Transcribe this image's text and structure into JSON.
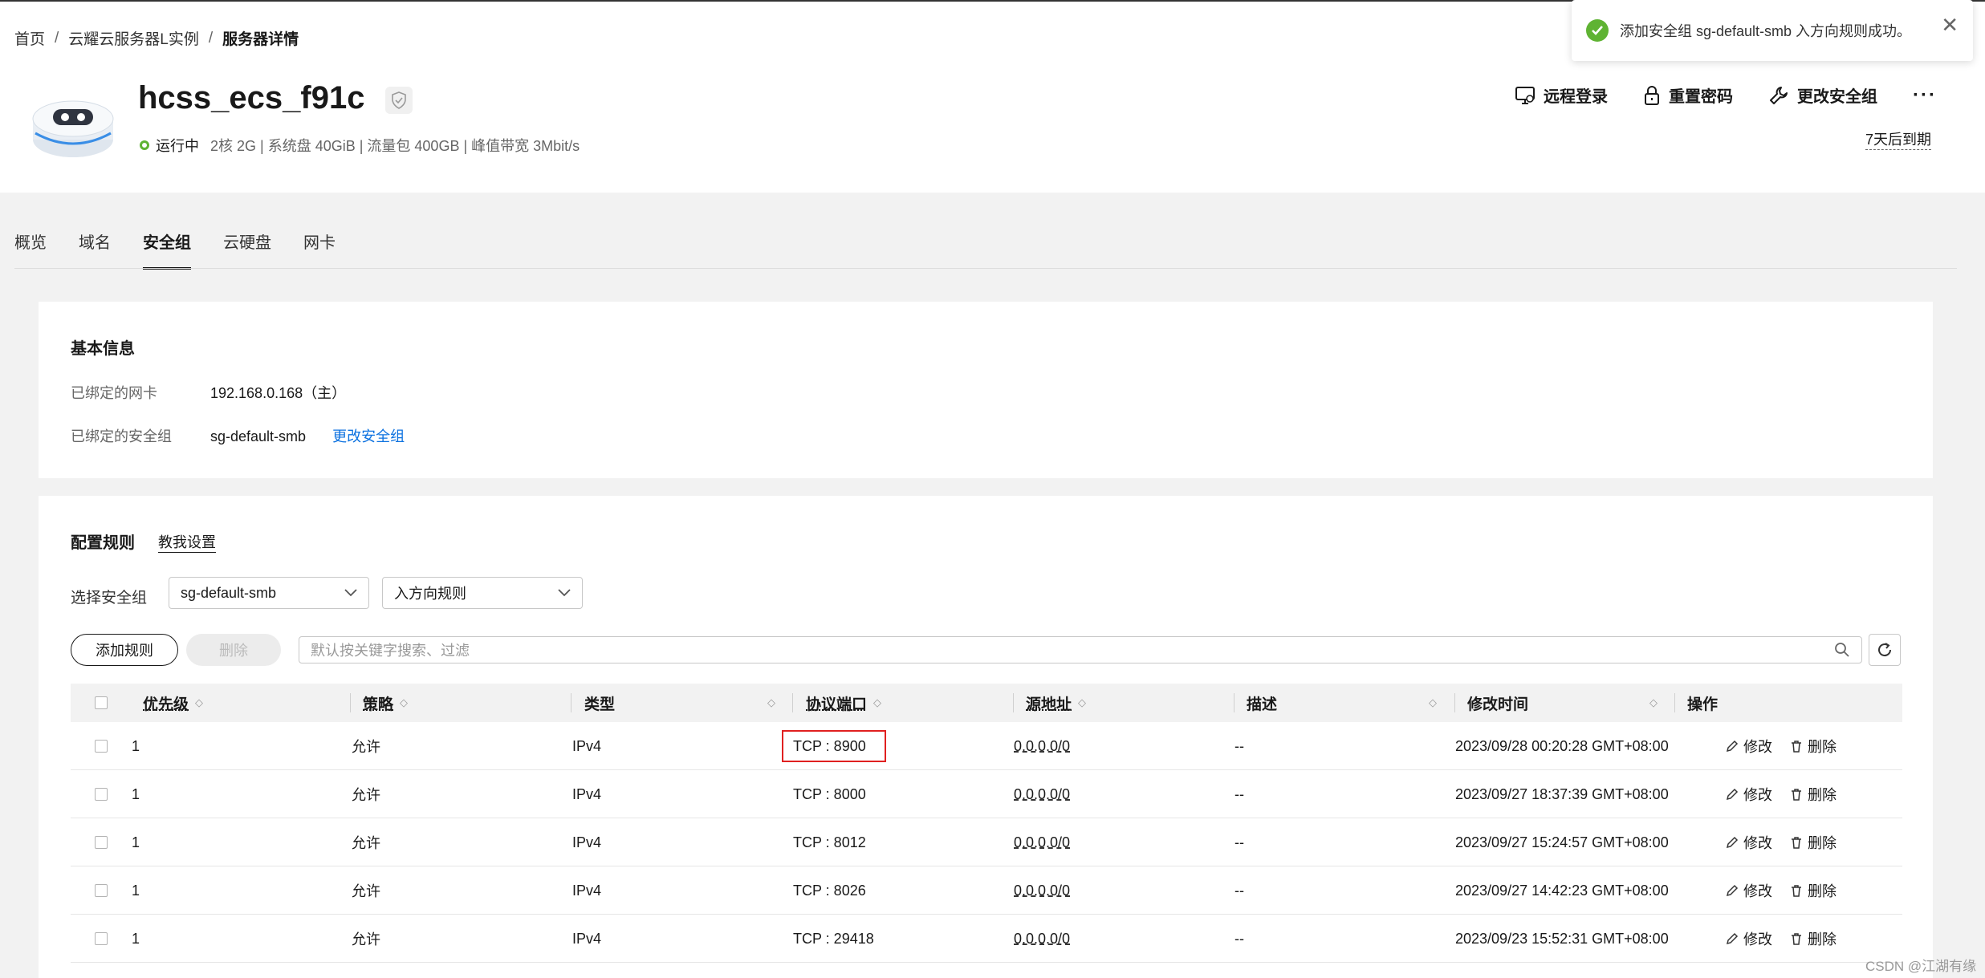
{
  "breadcrumb": {
    "home": "首页",
    "sep": "/",
    "level2": "云耀云服务器L实例",
    "current": "服务器详情"
  },
  "server": {
    "name": "hcss_ecs_f91c",
    "status": "运行中",
    "specs": "2核  2G | 系统盘 40GiB | 流量包 400GB | 峰值带宽 3Mbit/s",
    "expire": "7天后到期"
  },
  "actions": {
    "remote_login": "远程登录",
    "reset_password": "重置密码",
    "change_sg": "更改安全组",
    "more": "···"
  },
  "toast": {
    "message": "添加安全组 sg-default-smb 入方向规则成功。"
  },
  "tabs": [
    "概览",
    "域名",
    "安全组",
    "云硬盘",
    "网卡"
  ],
  "basic": {
    "title": "基本信息",
    "nic_label": "已绑定的网卡",
    "nic_value": "192.168.0.168（主）",
    "sg_label": "已绑定的安全组",
    "sg_value": "sg-default-smb",
    "sg_link": "更改安全组"
  },
  "rules": {
    "title": "配置规则",
    "guide": "教我设置",
    "select_label": "选择安全组",
    "sg_select": "sg-default-smb",
    "direction_select": "入方向规则",
    "add_btn": "添加规则",
    "delete_btn": "删除",
    "search_placeholder": "默认按关键字搜索、过滤"
  },
  "table": {
    "headers": {
      "priority": "优先级",
      "policy": "策略",
      "type": "类型",
      "port": "协议端口",
      "source": "源地址",
      "desc": "描述",
      "time": "修改时间",
      "ops": "操作"
    },
    "rows": [
      {
        "priority": "1",
        "policy": "允许",
        "type": "IPv4",
        "port": "TCP : 8900",
        "source": "0.0.0.0/0",
        "desc": "--",
        "time": "2023/09/28 00:20:28 GMT+08:00"
      },
      {
        "priority": "1",
        "policy": "允许",
        "type": "IPv4",
        "port": "TCP : 8000",
        "source": "0.0.0.0/0",
        "desc": "--",
        "time": "2023/09/27 18:37:39 GMT+08:00"
      },
      {
        "priority": "1",
        "policy": "允许",
        "type": "IPv4",
        "port": "TCP : 8012",
        "source": "0.0.0.0/0",
        "desc": "--",
        "time": "2023/09/27 15:24:57 GMT+08:00"
      },
      {
        "priority": "1",
        "policy": "允许",
        "type": "IPv4",
        "port": "TCP : 8026",
        "source": "0.0.0.0/0",
        "desc": "--",
        "time": "2023/09/27 14:42:23 GMT+08:00"
      },
      {
        "priority": "1",
        "policy": "允许",
        "type": "IPv4",
        "port": "TCP : 29418",
        "source": "0.0.0.0/0",
        "desc": "--",
        "time": "2023/09/23 15:52:31 GMT+08:00"
      }
    ],
    "edit": "修改",
    "delete": "删除"
  },
  "watermark": "CSDN @江湖有缘",
  "colors": {
    "accent": "#0d72e0",
    "success": "#5fb333",
    "highlight": "#e02020"
  }
}
